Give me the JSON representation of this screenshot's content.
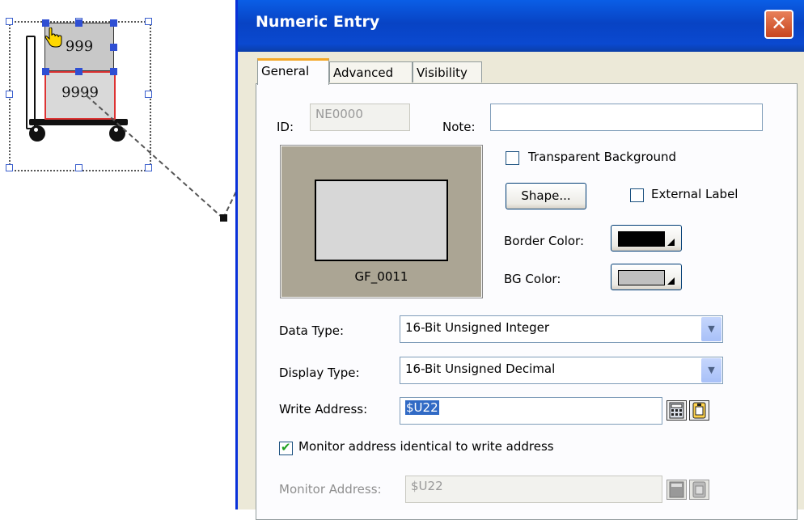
{
  "canvas": {
    "box_top_text": "999",
    "box_bottom_text": "9999"
  },
  "dialog": {
    "title": "Numeric Entry",
    "close_glyph": "✕",
    "tabs": [
      "General",
      "Advanced",
      "Visibility"
    ],
    "active_tab": "General",
    "general": {
      "id_label": "ID:",
      "id_value": "NE0000",
      "note_label": "Note:",
      "note_value": "",
      "preview_label": "GF_0011",
      "transparent_bg_label": "Transparent Background",
      "transparent_bg_checked": false,
      "shape_button": "Shape...",
      "external_label_label": "External Label",
      "external_label_checked": false,
      "border_color_label": "Border Color:",
      "border_color": "#000000",
      "bg_color_label": "BG Color:",
      "bg_color": "#c0c0c0",
      "data_type_label": "Data Type:",
      "data_type_value": "16-Bit Unsigned Integer",
      "display_type_label": "Display Type:",
      "display_type_value": "16-Bit Unsigned Decimal",
      "write_address_label": "Write Address:",
      "write_address_value": "$U22",
      "monitor_identical_label": "Monitor address identical to write address",
      "monitor_identical_checked": true,
      "monitor_address_label": "Monitor Address:",
      "monitor_address_value": "$U22"
    }
  },
  "colors": {
    "titlebar": "#0843c4",
    "dialog_bg": "#ece9d8",
    "tab_highlight": "#f3a726",
    "selection": "#316ac5"
  }
}
